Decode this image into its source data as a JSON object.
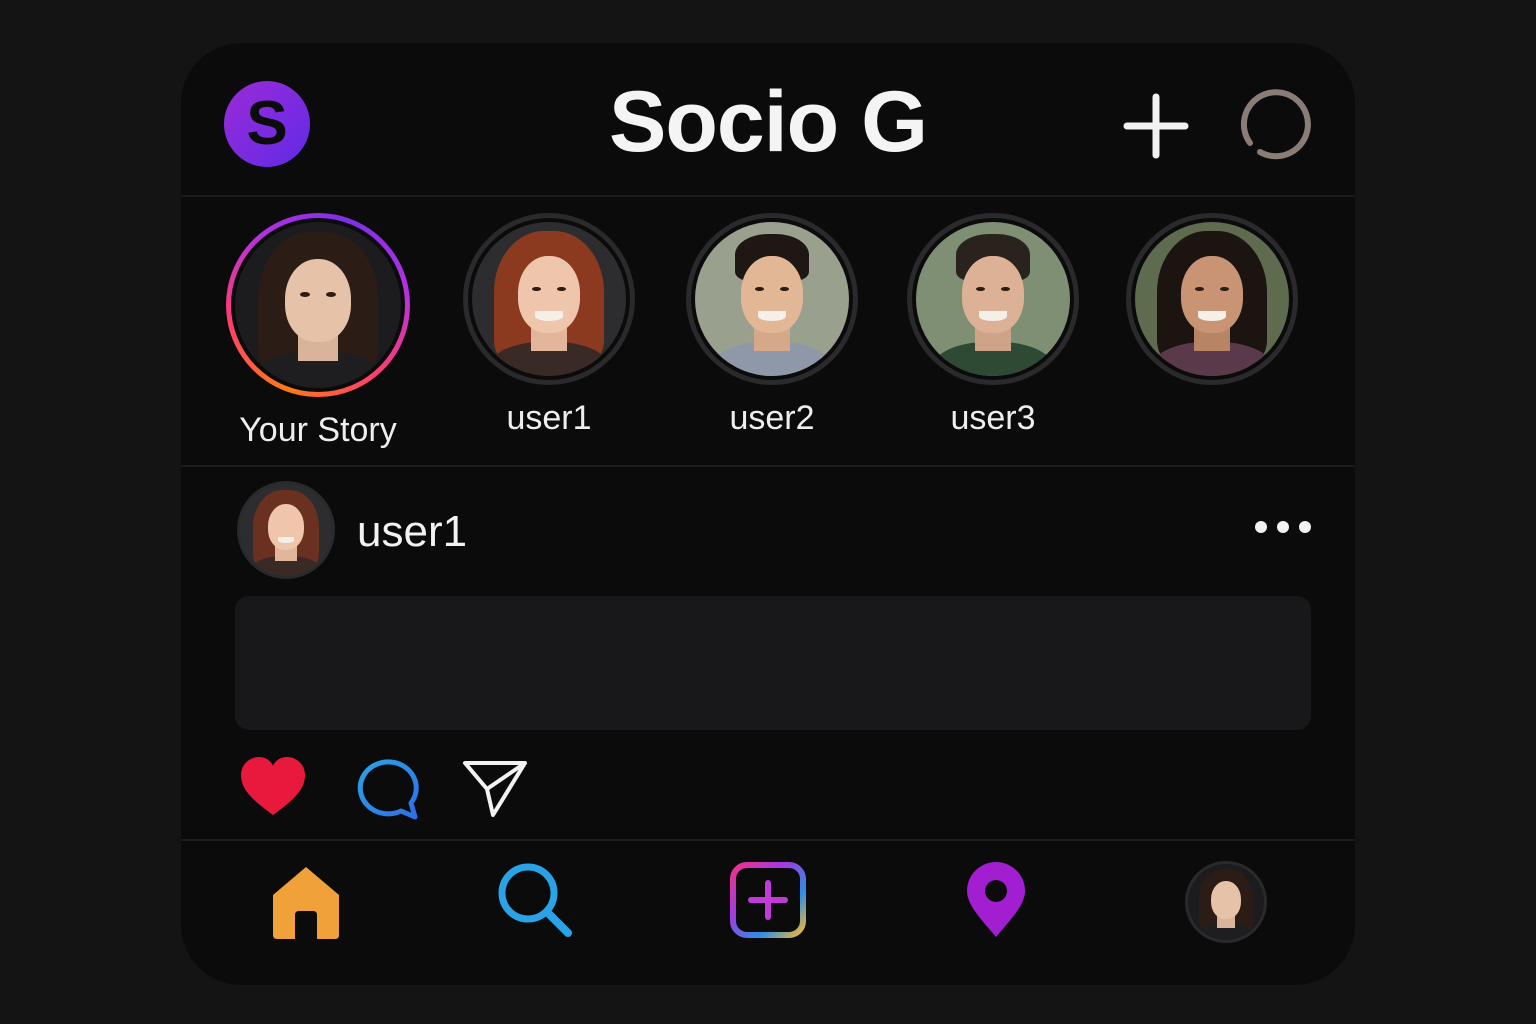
{
  "app": {
    "title": "Socio G",
    "logo_letter": "S"
  },
  "header": {
    "new_post_icon": "plus-icon",
    "activity_icon": "ring-icon"
  },
  "stories": [
    {
      "label": "Your Story",
      "active": true
    },
    {
      "label": "user1",
      "active": false
    },
    {
      "label": "user2",
      "active": false
    },
    {
      "label": "user3",
      "active": false
    },
    {
      "label": "",
      "active": false
    }
  ],
  "post": {
    "username": "user1",
    "more_icon": "more-horizontal-icon",
    "actions": [
      "heart-icon",
      "comment-icon",
      "send-icon"
    ]
  },
  "tabbar": {
    "items": [
      "home-icon",
      "search-icon",
      "create-icon",
      "location-pin-icon",
      "profile-avatar"
    ]
  },
  "colors": {
    "background": "#141414",
    "panel": "#0b0b0c",
    "like": "#e8193c",
    "comment": "#2f8ee6",
    "home": "#f0a13a",
    "search": "#2aa3e6",
    "pin": "#a21fd1",
    "logo": "#7a2be0"
  }
}
